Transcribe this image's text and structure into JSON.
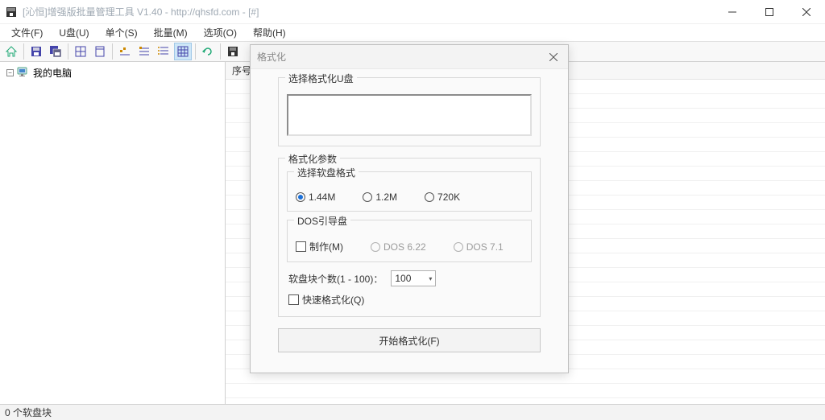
{
  "window": {
    "title": "[沁恒]增强版批量管理工具 V1.40 - http://qhsfd.com - [#]"
  },
  "menus": {
    "file": "文件(F)",
    "udisk": "U盘(U)",
    "single": "单个(S)",
    "batch": "批量(M)",
    "options": "选项(O)",
    "help": "帮助(H)"
  },
  "tree": {
    "root": "我的电脑"
  },
  "list": {
    "col_seq": "序号"
  },
  "status": {
    "text": "0 个软盘块"
  },
  "dialog": {
    "title": "格式化",
    "select_disk_legend": "选择格式化U盘",
    "params_legend": "格式化参数",
    "floppy_format_legend": "选择软盘格式",
    "radio_144m": "1.44M",
    "radio_12m": "1.2M",
    "radio_720k": "720K",
    "dos_boot_legend": "DOS引导盘",
    "make_checkbox": "制作(M)",
    "dos622": "DOS 6.22",
    "dos71": "DOS 7.1",
    "block_count_label": "软盘块个数(1 - 100)：",
    "block_count_value": "100",
    "quick_format": "快速格式化(Q)",
    "start_button": "开始格式化(F)"
  }
}
